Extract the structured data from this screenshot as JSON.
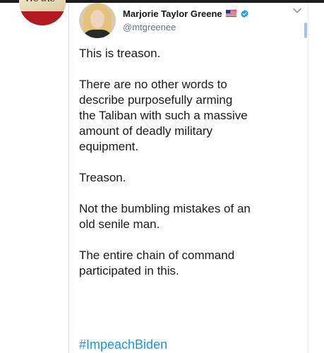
{
  "tweet": {
    "author_name": "Marjorie Taylor Greene",
    "handle": "@mtgreenee",
    "paragraphs": [
      "This is treason.",
      "There are no other words to\ndescribe purposefully arming\nthe Taliban with such a massive\namount of deadly military\nequipment.",
      "Treason.",
      "Not the bumbling mistakes of an\nold senile man.",
      "The entire chain of command\nparticipated in this."
    ],
    "hashtag": "#ImpeachBiden"
  },
  "icons": {
    "flag": "us-flag-icon",
    "verified": "verified-badge-icon",
    "menu": "chevron-down-icon"
  },
  "colors": {
    "link": "#1b95e0",
    "handle": "#657786",
    "verified": "#1da1f2",
    "text": "#1a1a1a"
  }
}
